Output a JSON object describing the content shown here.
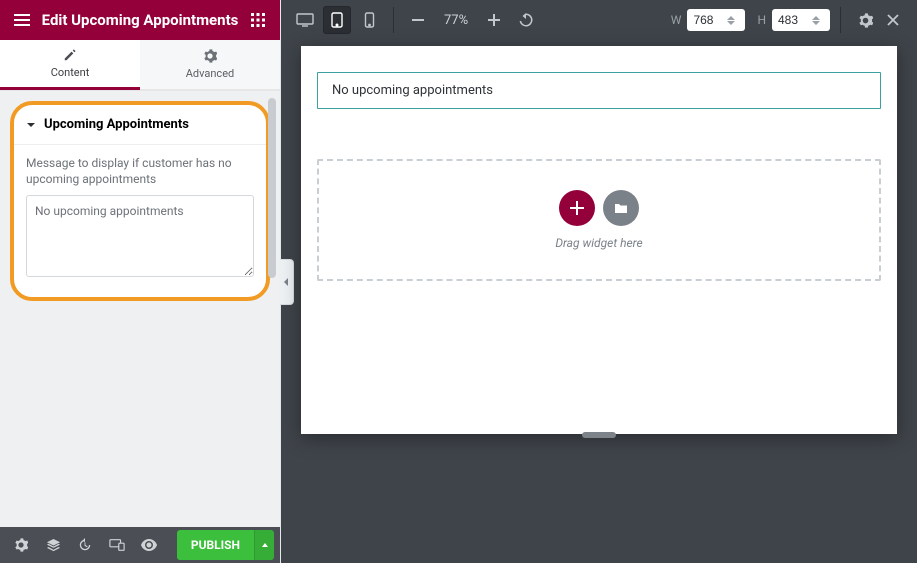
{
  "sidebar": {
    "title": "Edit Upcoming Appointments",
    "tabs": {
      "content": "Content",
      "advanced": "Advanced"
    },
    "section": {
      "title": "Upcoming Appointments",
      "field_label": "Message to display if customer has no upcoming appointments",
      "field_value": "No upcoming appointments"
    },
    "footer": {
      "publish": "PUBLISH"
    }
  },
  "toolbar": {
    "zoom_percent": "77%",
    "width_label": "W",
    "width_value": "768",
    "height_label": "H",
    "height_value": "483"
  },
  "canvas": {
    "empty_message": "No upcoming appointments",
    "drop_hint": "Drag widget here"
  }
}
